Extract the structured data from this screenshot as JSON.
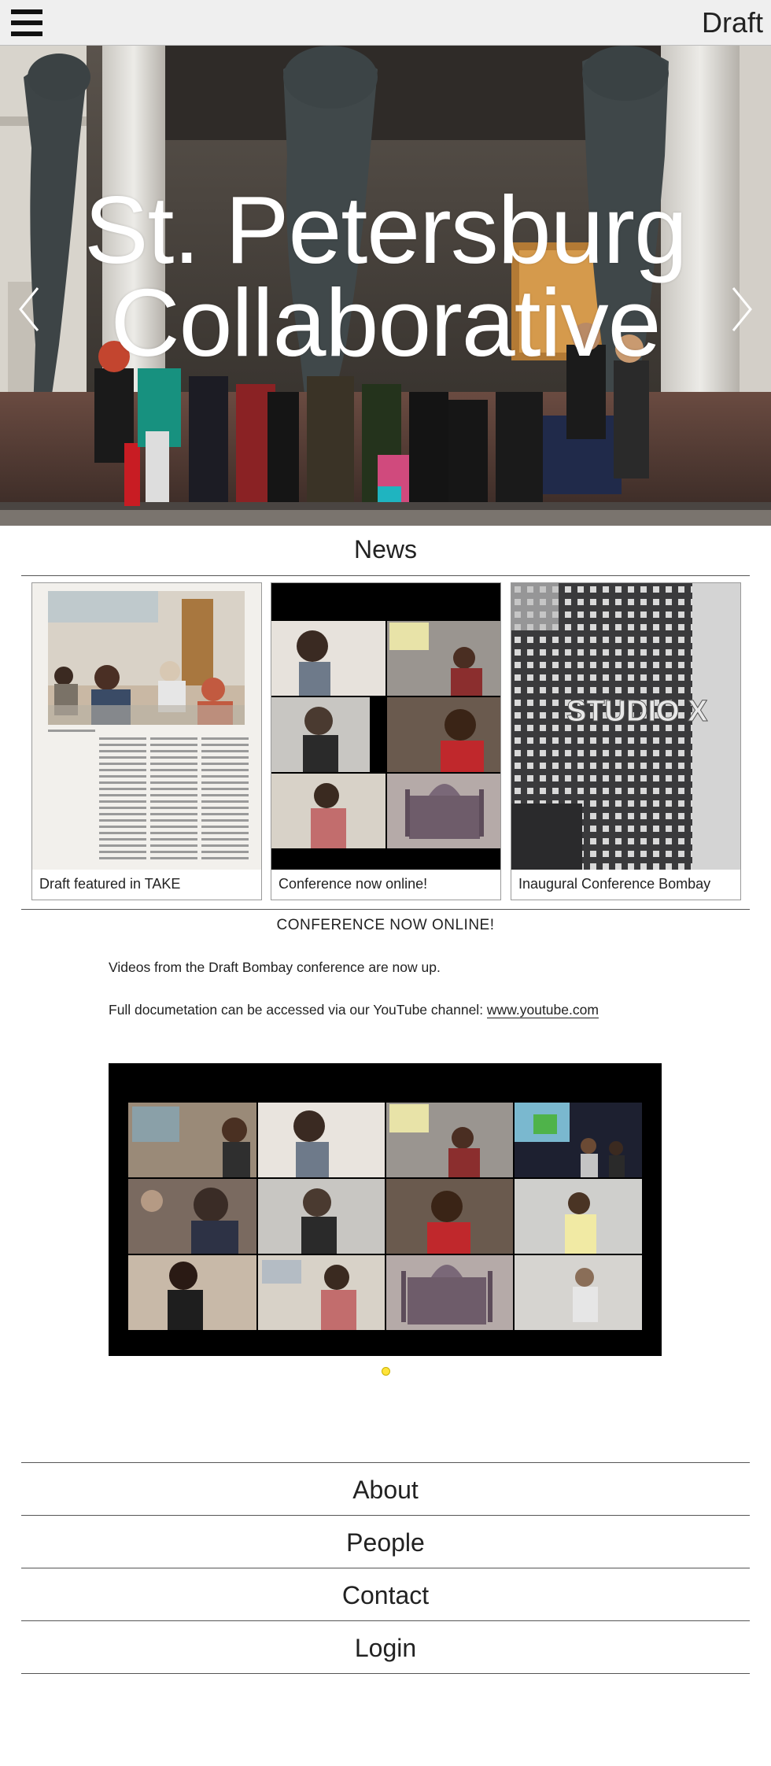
{
  "header": {
    "menu_icon": "hamburger-menu-icon",
    "brand": "Draft"
  },
  "hero": {
    "title_line1": "St. Petersburg",
    "title_line2": "Collaborative",
    "prev_icon": "chevron-left-icon",
    "next_icon": "chevron-right-icon"
  },
  "news": {
    "heading": "News",
    "cards": [
      {
        "caption": "Draft featured in TAKE"
      },
      {
        "caption": "Conference now online!"
      },
      {
        "caption": "Inaugural Conference Bombay",
        "sign_text": "STUDIO X"
      }
    ]
  },
  "article": {
    "title": "CONFERENCE NOW ONLINE!",
    "paragraph1": "Videos from the Draft Bombay conference are now up.",
    "paragraph2_prefix": "Full documetation can be accessed via our YouTube channel: ",
    "paragraph2_link": "www.youtube.com",
    "slide_indicator_color": "#ffe33a"
  },
  "footer_nav": {
    "items": [
      {
        "label": "About"
      },
      {
        "label": "People"
      },
      {
        "label": "Contact"
      },
      {
        "label": "Login"
      }
    ]
  }
}
